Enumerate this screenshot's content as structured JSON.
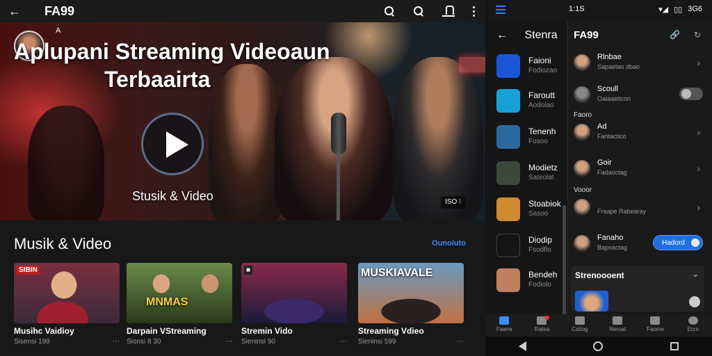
{
  "left_app": {
    "title": "FA99",
    "hero": {
      "logo_mark": "A",
      "title_line1": "Aplupani Streaming Videoaun",
      "title_line2": "Terbaairta",
      "subtitle": "Stusik & Video",
      "badge": "ISO ⁝"
    },
    "section": {
      "title": "Musik & Video",
      "link": "Ounoiuto"
    },
    "cards": [
      {
        "title": "Musihc Vaidioy",
        "meta": "Sisensi 199",
        "tag": "SIBIN"
      },
      {
        "title": "Darpain VStreaming",
        "meta": "Sionsi 8 30",
        "thumb_text": "MNMAS"
      },
      {
        "title": "Stremin Vido",
        "meta": "Sieninsi 90",
        "tag": "■"
      },
      {
        "title": "Streaming Vdieo",
        "meta": "Sieninsi 599",
        "thumb_text": "MUSKIAVALE"
      }
    ]
  },
  "phone": {
    "status_time": "1:1S",
    "status_right": [
      "▾◢",
      "▯▯",
      "3G6"
    ],
    "left_pane": {
      "title": "Stenra",
      "apps": [
        {
          "name": "Faioni",
          "sub": "Fodiozao",
          "color": "#1a56d6"
        },
        {
          "name": "Faroutt",
          "sub": "Aodoiao",
          "color": "#1aa0d8"
        },
        {
          "name": "Tenenh",
          "sub": "Fosoo",
          "color": "#2a6aa0"
        },
        {
          "name": "Modietz",
          "sub": "Sateolat",
          "color": "#3a4a3a"
        },
        {
          "name": "Stoabiok",
          "sub": "Sasoo",
          "color": "#d08a30"
        },
        {
          "name": "Diodip",
          "sub": "Fsodfio",
          "color": "#151515"
        },
        {
          "name": "Bendeh",
          "sub": "Fodiolo",
          "color": "#c08060"
        }
      ]
    },
    "right_pane": {
      "title": "FA99",
      "rows_top": [
        {
          "name": "Rlnbae",
          "sub": "Sapaetao dbao"
        },
        {
          "name": "Scoull",
          "sub": "Oalaaeticon"
        }
      ],
      "section1": "Faoro",
      "rows_mid": [
        {
          "name": "Ad",
          "sub": "Fantactico"
        },
        {
          "name": "Goir",
          "sub": "Fadaoctag"
        }
      ],
      "section2": "Vooor",
      "rows_bot": [
        {
          "name": "",
          "sub": "Fraape Rabearay"
        },
        {
          "name": "Fanaho",
          "sub": "Bapoactag",
          "button": "Hadord"
        }
      ],
      "stream_label": "Strenoooent"
    },
    "navbar": [
      "Faana",
      "Ratea",
      "Caitog",
      "Neroat",
      "Faome",
      "Ecro"
    ]
  }
}
